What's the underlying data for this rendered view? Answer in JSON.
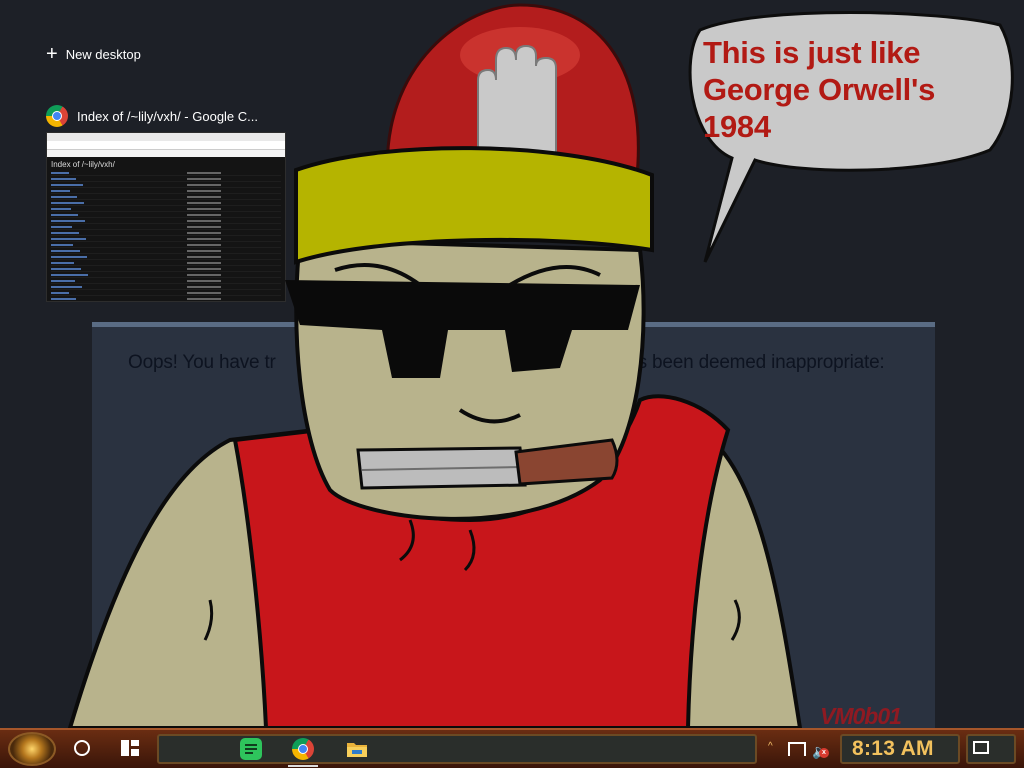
{
  "task_view": {
    "new_desktop_label": "New desktop",
    "window_title": "Index of /~lily/vxh/ - Google C...",
    "thumbnail": {
      "page_heading": "Index of /~lily/vxh/"
    }
  },
  "blocked_page": {
    "message": "Oops! You have tr",
    "message_end": "s been deemed inappropriate:"
  },
  "overlay_image": {
    "speech_line1": "This is just like",
    "speech_line2": "George Orwell's",
    "speech_line3": "1984",
    "signature": "VM0b01"
  },
  "taskbar": {
    "start_icon": "steampunk-orb-icon",
    "search_icon": "cortana-circle-icon",
    "taskview_icon": "task-view-icon",
    "apps": [
      {
        "name": "sticky-notes-icon"
      },
      {
        "name": "chrome-icon"
      },
      {
        "name": "file-explorer-icon"
      }
    ],
    "tray_icons": [
      "show-hidden-icons-chevron",
      "network-icon",
      "volume-muted-icon"
    ],
    "clock": "8:13 AM",
    "notification_icon": "action-center-icon"
  },
  "colors": {
    "speech_text": "#b21a14",
    "clock_text": "#f2c15d",
    "taskbar": "#5a240f",
    "shirt": "#c8161b",
    "hat": "#b5b400",
    "skin": "#b8b38c"
  }
}
